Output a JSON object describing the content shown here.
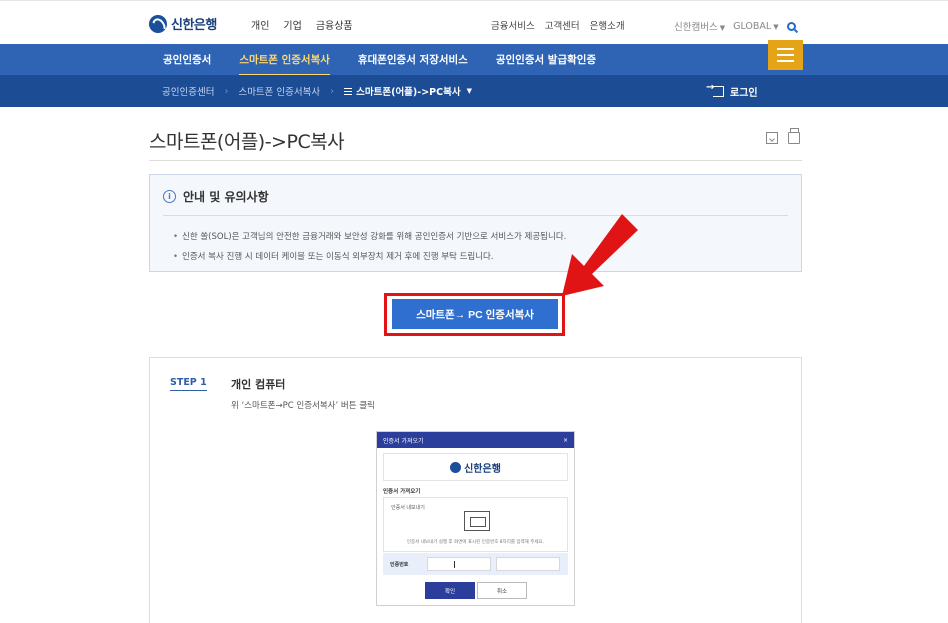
{
  "brand": {
    "name": "신한은행",
    "color": "#1a4f9c"
  },
  "top_nav": [
    "개인",
    "기업",
    "금융상품"
  ],
  "top_util": [
    "금융서비스",
    "고객센터",
    "은행소개"
  ],
  "top_right": {
    "campus": "신한캠버스",
    "global": "GLOBAL",
    "search_icon": "search-icon"
  },
  "main_nav": {
    "items": [
      {
        "label": "공인인증서",
        "active": false
      },
      {
        "label": "스마트폰 인증서복사",
        "active": true
      },
      {
        "label": "휴대폰인증서 저장서비스",
        "active": false
      },
      {
        "label": "공인인증서 발급확인증",
        "active": false
      }
    ],
    "menu_icon": "hamburger-icon",
    "bg_color": "#2f63b4",
    "active_color": "#ffd76a"
  },
  "breadcrumb": {
    "items": [
      "공인인증센터",
      "스마트폰 인증서복사"
    ],
    "current": "스마트폰(어플)->PC복사",
    "login_label": "로그인"
  },
  "page": {
    "title": "스마트폰(어플)->PC복사",
    "tools": [
      "save-icon",
      "print-icon"
    ]
  },
  "notice": {
    "heading": "안내 및 유의사항",
    "items": [
      "신한 쏠(SOL)은 고객님의 안전한 금융거래와 보안성 강화를 위해 공인인증서 기반으로 서비스가 제공됩니다.",
      "인증서 복사 진행 시 데이터 케이블 또는 이동식 외부장치 제거 후에 진행 부탁 드립니다."
    ]
  },
  "cta": {
    "label": "스마트폰→ PC 인증서복사",
    "highlight_color": "#e01414"
  },
  "step": {
    "label": "STEP 1",
    "title": "개인 컴퓨터",
    "desc": "위 ‘스마트폰→PC 인증서복사’ 버튼 클릭"
  },
  "dialog": {
    "title": "인증서 가져오기",
    "close": "×",
    "logo": "신한은행",
    "section": "인증서 가져오기",
    "panel_title": "인증서 내보내기",
    "panel_text": "인증서 내보내기 실행 후 화면에 표시된 인증번호 8자리를 입력해 주세요.",
    "input_label": "인증번호",
    "ok": "확인",
    "cancel": "취소"
  }
}
